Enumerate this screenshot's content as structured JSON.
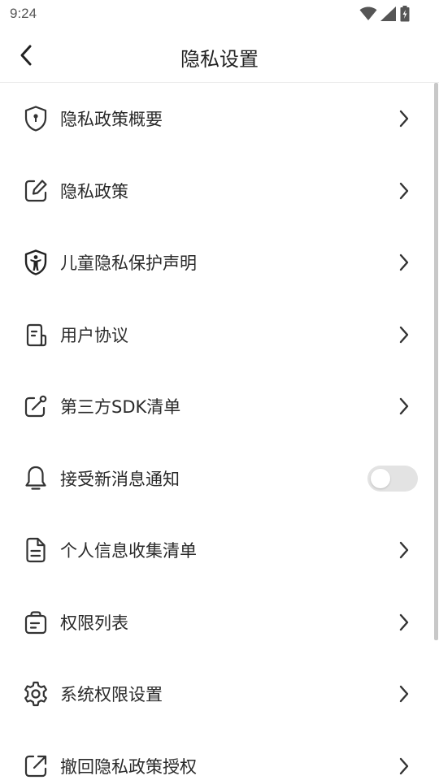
{
  "status_bar": {
    "time": "9:24"
  },
  "header": {
    "title": "隐私设置"
  },
  "colors": {
    "text": "#2a2a2a",
    "icon": "#333333",
    "toggle_off": "#e3e3e3"
  },
  "items": [
    {
      "label": "隐私政策概要",
      "icon": "shield-lock-icon",
      "control": "chevron"
    },
    {
      "label": "隐私政策",
      "icon": "edit-icon",
      "control": "chevron"
    },
    {
      "label": "儿童隐私保护声明",
      "icon": "child-shield-icon",
      "control": "chevron"
    },
    {
      "label": "用户协议",
      "icon": "document-icon",
      "control": "chevron"
    },
    {
      "label": "第三方SDK清单",
      "icon": "link-edit-icon",
      "control": "chevron"
    },
    {
      "label": "接受新消息通知",
      "icon": "bell-icon",
      "control": "toggle",
      "toggle_on": false
    },
    {
      "label": "个人信息收集清单",
      "icon": "file-list-icon",
      "control": "chevron"
    },
    {
      "label": "权限列表",
      "icon": "bag-icon",
      "control": "chevron"
    },
    {
      "label": "系统权限设置",
      "icon": "gear-icon",
      "control": "chevron"
    },
    {
      "label": "撤回隐私政策授权",
      "icon": "external-share-icon",
      "control": "chevron"
    }
  ]
}
